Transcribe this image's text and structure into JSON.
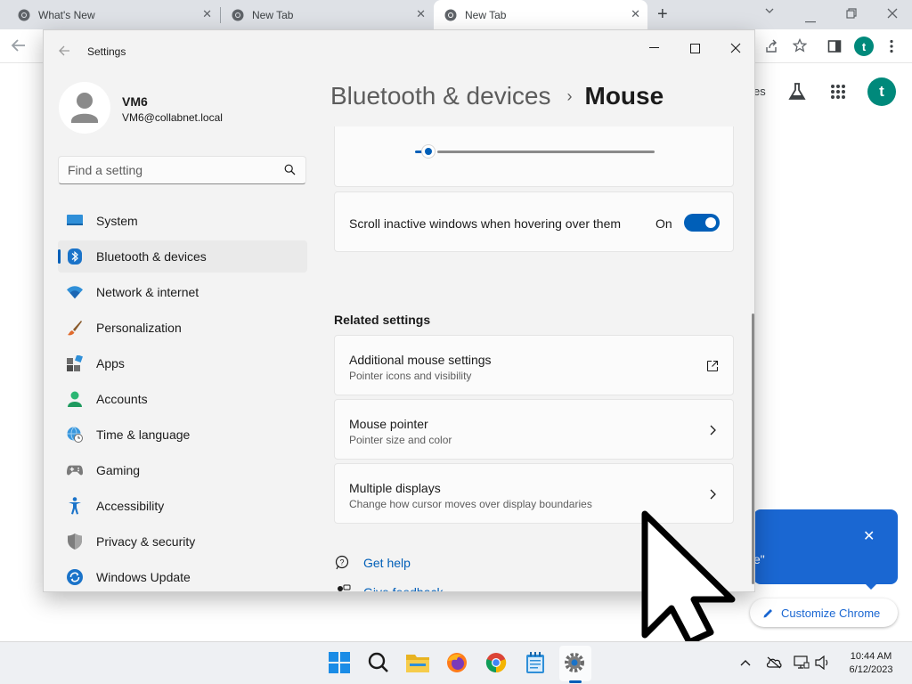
{
  "browser": {
    "tabs": [
      {
        "title": "What's New",
        "close": "✕"
      },
      {
        "title": "New Tab",
        "close": "✕"
      },
      {
        "title": "New Tab",
        "close": "✕"
      }
    ],
    "new_tab_symbol": "+",
    "profile_initial": "t",
    "ntp": {
      "partial_shortcut_text": "es",
      "avatar_initial": "t",
      "promo_partial_text": "e\"",
      "promo_close": "✕",
      "customize_label": "Customize Chrome"
    }
  },
  "settings": {
    "window_title": "Settings",
    "user": {
      "name": "VM6",
      "email": "VM6@collabnet.local"
    },
    "search_placeholder": "Find a setting",
    "nav": [
      {
        "label": "System",
        "icon": "system-icon"
      },
      {
        "label": "Bluetooth & devices",
        "icon": "bluetooth-icon",
        "selected": true
      },
      {
        "label": "Network & internet",
        "icon": "wifi-icon"
      },
      {
        "label": "Personalization",
        "icon": "brush-icon"
      },
      {
        "label": "Apps",
        "icon": "apps-icon"
      },
      {
        "label": "Accounts",
        "icon": "accounts-icon"
      },
      {
        "label": "Time & language",
        "icon": "globe-clock-icon"
      },
      {
        "label": "Gaming",
        "icon": "gamepad-icon"
      },
      {
        "label": "Accessibility",
        "icon": "accessibility-icon"
      },
      {
        "label": "Privacy & security",
        "icon": "shield-icon"
      },
      {
        "label": "Windows Update",
        "icon": "update-icon"
      }
    ],
    "breadcrumb": {
      "parent": "Bluetooth & devices",
      "separator": "›",
      "current": "Mouse"
    },
    "scroll_inactive": {
      "label": "Scroll inactive windows when hovering over them",
      "state": "On",
      "enabled": true
    },
    "related_title": "Related settings",
    "related": [
      {
        "title": "Additional mouse settings",
        "subtitle": "Pointer icons and visibility",
        "icon": "external-link-icon"
      },
      {
        "title": "Mouse pointer",
        "subtitle": "Pointer size and color",
        "icon": "chevron-right-icon"
      },
      {
        "title": "Multiple displays",
        "subtitle": "Change how cursor moves over display boundaries",
        "icon": "chevron-right-icon"
      }
    ],
    "help": {
      "get_help": "Get help",
      "give_feedback": "Give feedback"
    }
  },
  "taskbar": {
    "time": "10:44 AM",
    "date": "6/12/2023",
    "apps": [
      "start-icon",
      "search-icon",
      "file-explorer-icon",
      "firefox-icon",
      "chrome-icon",
      "notepad-icon",
      "settings-gear-icon"
    ]
  },
  "colors": {
    "accent": "#005fb8",
    "chrome_blue": "#1a67d2",
    "avatar_teal": "#00897b"
  }
}
